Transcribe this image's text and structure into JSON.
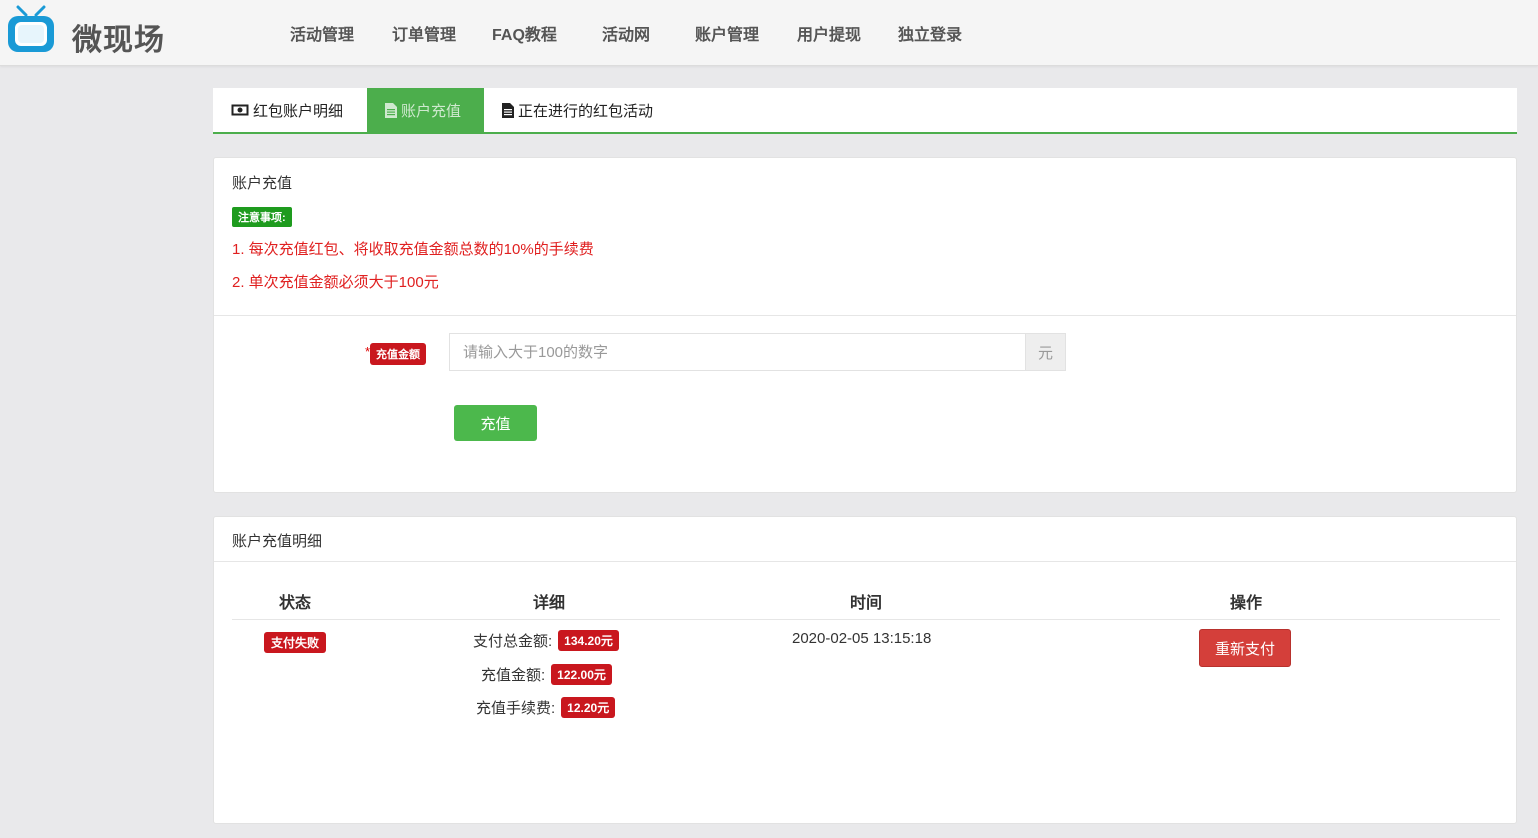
{
  "header": {
    "logo_text": "微现场",
    "nav": [
      "活动管理",
      "订单管理",
      "FAQ教程",
      "活动网",
      "账户管理",
      "用户提现",
      "独立登录"
    ]
  },
  "tabs": [
    {
      "label": "红包账户明细",
      "icon": "money-icon"
    },
    {
      "label": "账户充值",
      "icon": "document-icon",
      "active": true
    },
    {
      "label": "正在进行的红包活动",
      "icon": "document-icon"
    }
  ],
  "recharge": {
    "title": "账户充值",
    "notice_badge": "注意事项:",
    "notices": [
      "1. 每次充值红包、将收取充值金额总数的10%的手续费",
      "2. 单次充值金额必须大于100元"
    ],
    "required_mark": "*",
    "amount_label": "充值金额",
    "amount_value": "",
    "amount_placeholder": "请输入大于100的数字",
    "unit": "元",
    "submit_label": "充值"
  },
  "history": {
    "title": "账户充值明细",
    "columns": [
      "状态",
      "详细",
      "时间",
      "操作"
    ],
    "rows": [
      {
        "status": "支付失败",
        "details": [
          {
            "label": "支付总金额:",
            "value": "134.20元"
          },
          {
            "label": "充值金额:",
            "value": "122.00元"
          },
          {
            "label": "充值手续费:",
            "value": "12.20元"
          }
        ],
        "time": "2020-02-05 13:15:18",
        "action": "重新支付"
      }
    ]
  },
  "colors": {
    "accent_green": "#4cae4c",
    "danger_red": "#c9171e",
    "notice_red": "#e02020"
  }
}
